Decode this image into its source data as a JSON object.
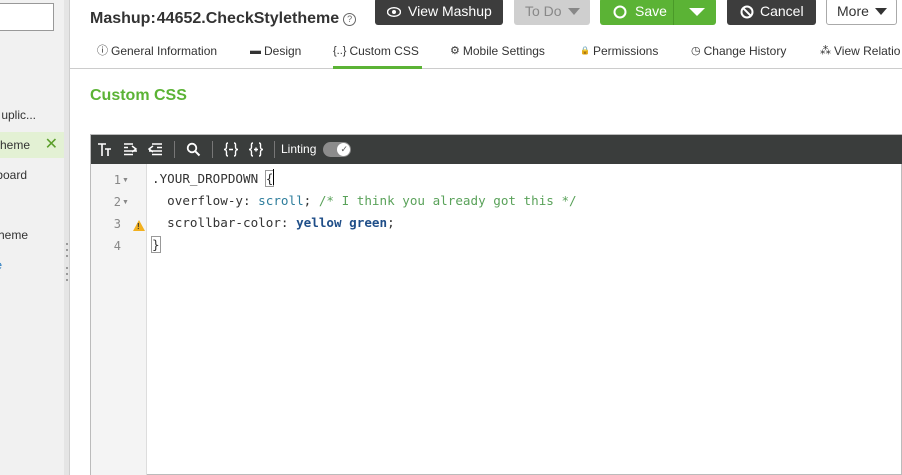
{
  "sidebar": {
    "items": [
      {
        "label": "uplic..."
      },
      {
        "label": "heme",
        "selected": true,
        "close": "✕"
      },
      {
        "label": "board"
      },
      {
        "label": "heme"
      },
      {
        "label": "e"
      }
    ]
  },
  "header": {
    "label": "Mashup:",
    "name": "44652.CheckStyletheme",
    "help_icon": "?"
  },
  "buttons": {
    "view_mashup": "View Mashup",
    "todo": "To Do",
    "save": "Save",
    "cancel": "Cancel",
    "more": "More"
  },
  "tabs": [
    {
      "icon": "ⓘ",
      "label": "General Information"
    },
    {
      "icon": "▬",
      "label": "Design"
    },
    {
      "icon": "{..}",
      "label": "Custom CSS",
      "active": true
    },
    {
      "icon": "⚙",
      "label": "Mobile Settings"
    },
    {
      "icon": "🔒",
      "label": "Permissions"
    },
    {
      "icon": "◷",
      "label": "Change History"
    },
    {
      "icon": "⁂",
      "label": "View Relatio"
    }
  ],
  "section_title": "Custom CSS",
  "editor": {
    "linting_label": "Linting",
    "linting_on": true,
    "line_numbers": [
      "1",
      "2",
      "3",
      "4"
    ],
    "lines": [
      {
        "selector": ".YOUR_DROPDOWN",
        "open": "{"
      },
      {
        "prop": "overflow-y",
        "value": "scroll",
        "comment": "/* I think you already got this */"
      },
      {
        "prop": "scrollbar-color",
        "value": "yellow green"
      },
      {
        "close": "}"
      }
    ]
  },
  "colors": {
    "accent_green": "#5bb335",
    "dark_button": "#3d3d3d",
    "toolbar": "#3a3d3c",
    "warning": "#f2b01e"
  }
}
